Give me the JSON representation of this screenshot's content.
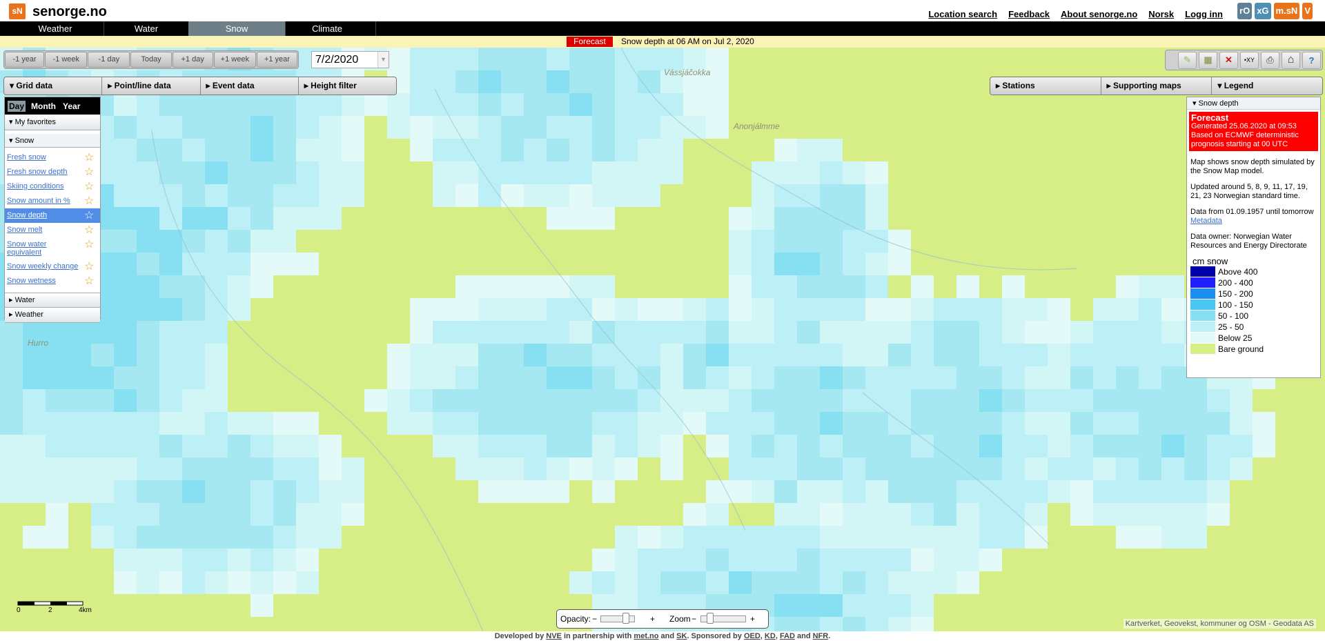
{
  "header": {
    "logo_mark": "sN",
    "title": "senorge.no",
    "links": [
      "Location search",
      "Feedback",
      "About senorge.no",
      "Norsk",
      "Logg inn"
    ],
    "ext_logos": [
      {
        "label": "rO",
        "color": "#5f7f95"
      },
      {
        "label": "xG",
        "color": "#4e8fb2"
      },
      {
        "label": "m.sN",
        "color": "#e8731a"
      },
      {
        "label": "V",
        "color": "#e8731a"
      }
    ]
  },
  "tabs": [
    {
      "label": "Weather",
      "active": false
    },
    {
      "label": "Water",
      "active": false
    },
    {
      "label": "Snow",
      "active": true
    },
    {
      "label": "Climate",
      "active": false
    }
  ],
  "info": {
    "badge": "Forecast",
    "text": "Snow depth at 06 AM  on Jul 2, 2020"
  },
  "date_nav": {
    "buttons": [
      "-1 year",
      "-1 week",
      "-1 day",
      "Today",
      "+1 day",
      "+1 week",
      "+1 year"
    ],
    "date_value": "7/2/2020"
  },
  "tools": [
    {
      "name": "pencil-icon",
      "glyph": "✎",
      "color": "#8fbf4f"
    },
    {
      "name": "grid-layers-icon",
      "glyph": "▦",
      "color": "#7a8a3a"
    },
    {
      "name": "clear-x-icon",
      "glyph": "✕",
      "color": "#cc1111"
    },
    {
      "name": "xy-coordinate-icon",
      "glyph": "XY",
      "color": "#000"
    },
    {
      "name": "print-icon",
      "glyph": "⎙",
      "color": "#333"
    },
    {
      "name": "home-icon",
      "glyph": "⌂",
      "color": "#333"
    },
    {
      "name": "help-icon",
      "glyph": "?",
      "color": "#2c6fb5"
    }
  ],
  "left_panels": [
    "Grid data",
    "Point/line data",
    "Event data",
    "Height filter"
  ],
  "right_panels": [
    "Stations",
    "Supporting maps",
    "Legend"
  ],
  "sidebar": {
    "periods": [
      {
        "label": "Day",
        "active": true
      },
      {
        "label": "Month",
        "active": false
      },
      {
        "label": "Year",
        "active": false
      }
    ],
    "favorites_label": "My favorites",
    "snow_label": "Snow",
    "snow_items": [
      {
        "label": "Fresh snow",
        "active": false,
        "two_line": false
      },
      {
        "label": "Fresh snow depth",
        "active": false,
        "two_line": false
      },
      {
        "label": "Skiing conditions",
        "active": false,
        "two_line": false
      },
      {
        "label": "Snow amount in %",
        "active": false,
        "two_line": false
      },
      {
        "label": "Snow depth",
        "active": true,
        "two_line": false
      },
      {
        "label": "Snow melt",
        "active": false,
        "two_line": false
      },
      {
        "label": "Snow water equivalent",
        "active": false,
        "two_line": true
      },
      {
        "label": "Snow weekly change",
        "active": false,
        "two_line": false
      },
      {
        "label": "Snow wetness",
        "active": false,
        "two_line": false
      }
    ],
    "water_label": "Water",
    "weather_label": "Weather"
  },
  "legend": {
    "header": "Snow depth",
    "forecast_title": "Forecast",
    "forecast_lines": [
      "Generated 25.06.2020 at 09:53",
      "Based on ECMWF deterministic prognosis starting at 00 UTC"
    ],
    "desc": "Map shows snow depth simulated by the Snow Map model.",
    "updated": "Updated around 5, 8, 9, 11, 17, 19, 21, 23 Norwegian standard time.",
    "data_range": "Data from 01.09.1957 until tomorrow",
    "metadata_link": "Metadata",
    "owner": "Data owner: Norwegian Water Resources and Energy Directorate",
    "unit_title": "cm snow",
    "classes": [
      {
        "label": "Above  400",
        "color": "#0000a8"
      },
      {
        "label": "200 - 400",
        "color": "#1f1fff"
      },
      {
        "label": "150 - 200",
        "color": "#1b8ff0"
      },
      {
        "label": "100 - 150",
        "color": "#4ac7f0"
      },
      {
        "label": "50 - 100",
        "color": "#87dff2"
      },
      {
        "label": "25 - 50",
        "color": "#bdf0f6"
      },
      {
        "label": "Below 25",
        "color": "#e3faf9"
      },
      {
        "label": "Bare ground",
        "color": "#d7ee86"
      }
    ]
  },
  "map": {
    "places": [
      "Vássjáčokka",
      "Anonjálmme",
      "Hurro"
    ],
    "scale_labels": [
      "0",
      "2",
      "4km"
    ],
    "opacity_label": "Opacity:",
    "zoom_label": "Zoom",
    "attribution": "Kartverket, Geovekst, kommuner og OSM - Geodata AS"
  },
  "footer": {
    "t1": "Developed by ",
    "nve": "NVE",
    "t2": " in partnership with ",
    "met": "met.no",
    "t3": " and ",
    "sk": "SK",
    "t4": ". Sponsored by ",
    "oed": "OED",
    "t5": ", ",
    "kd": "KD",
    "t6": ", ",
    "fad": "FAD",
    "t7": " and ",
    "nfr": "NFR",
    "t8": "."
  }
}
